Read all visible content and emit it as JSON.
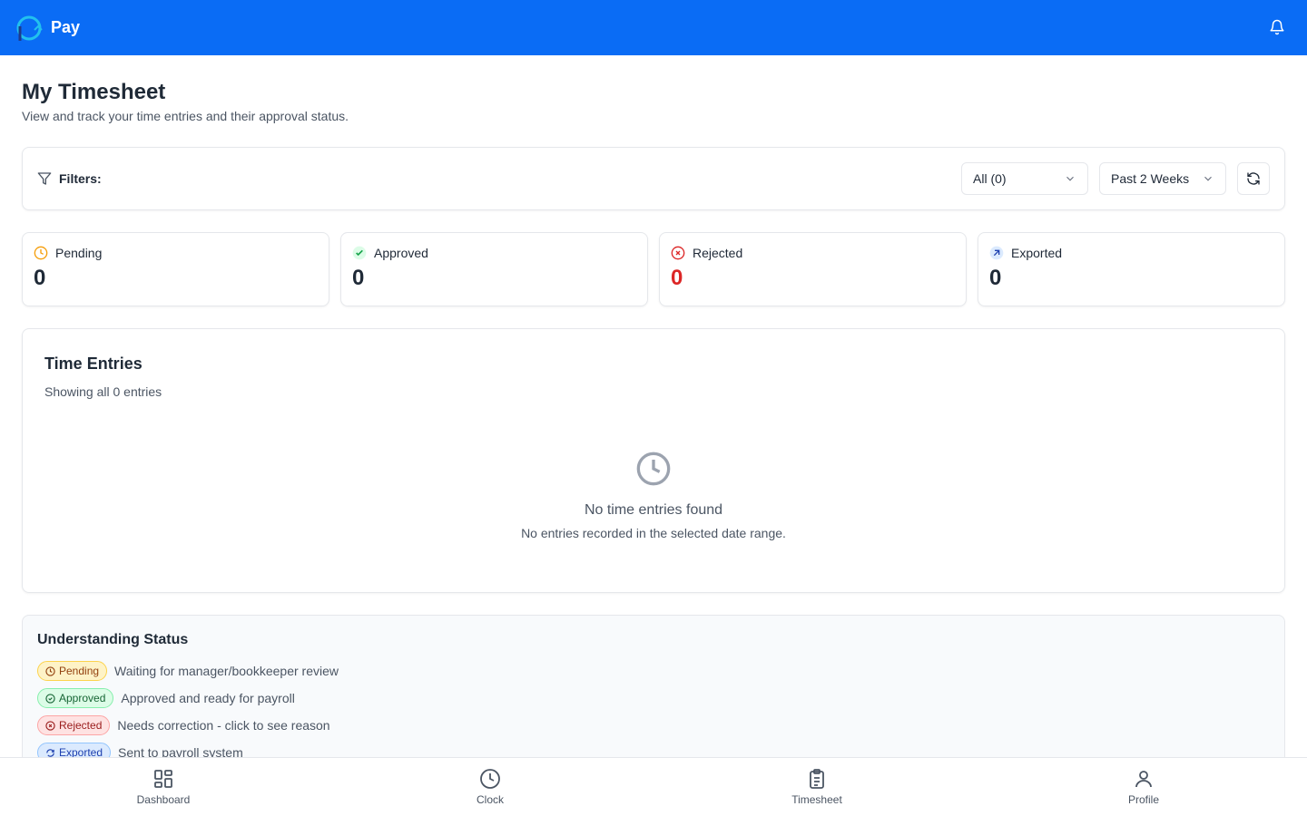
{
  "header": {
    "brand": "Pay"
  },
  "page": {
    "title": "My Timesheet",
    "subtitle": "View and track your time entries and their approval status."
  },
  "filters": {
    "label": "Filters:",
    "status_value": "All (0)",
    "range_value": "Past 2 Weeks"
  },
  "stats": [
    {
      "label": "Pending",
      "value": "0",
      "color": "#f59e0b"
    },
    {
      "label": "Approved",
      "value": "0",
      "color": "#16a34a"
    },
    {
      "label": "Rejected",
      "value": "0",
      "color": "#dc2626"
    },
    {
      "label": "Exported",
      "value": "0",
      "color": "#2563eb"
    }
  ],
  "entries": {
    "title": "Time Entries",
    "subtitle": "Showing all 0 entries",
    "empty_title": "No time entries found",
    "empty_subtitle": "No entries recorded in the selected date range."
  },
  "legend": {
    "title": "Understanding Status",
    "items": [
      {
        "badge": "Pending",
        "text": "Waiting for manager/bookkeeper review"
      },
      {
        "badge": "Approved",
        "text": "Approved and ready for payroll"
      },
      {
        "badge": "Rejected",
        "text": "Needs correction - click to see reason"
      },
      {
        "badge": "Exported",
        "text": "Sent to payroll system"
      }
    ]
  },
  "nav": [
    {
      "label": "Dashboard",
      "icon": "grid-icon"
    },
    {
      "label": "Clock",
      "icon": "clock-icon"
    },
    {
      "label": "Timesheet",
      "icon": "clipboard-icon"
    },
    {
      "label": "Profile",
      "icon": "user-icon"
    }
  ],
  "colors": {
    "brand": "#0a6cf5"
  }
}
